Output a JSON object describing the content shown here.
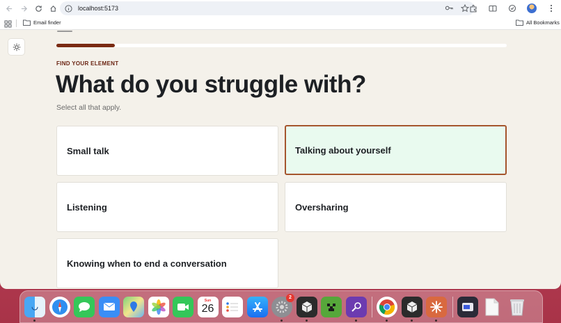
{
  "browser": {
    "url": "localhost:5173",
    "bookmarks": {
      "folder_1": "Email finder",
      "all_bookmarks": "All Bookmarks"
    }
  },
  "quiz": {
    "progress_fraction": 0.13,
    "eyebrow": "FIND YOUR ELEMENT",
    "title": "What do you struggle with?",
    "subtitle": "Select all that apply.",
    "options": [
      {
        "label": "Small talk",
        "selected": false
      },
      {
        "label": "Talking about yourself",
        "selected": true
      },
      {
        "label": "Listening",
        "selected": false
      },
      {
        "label": "Oversharing",
        "selected": false
      },
      {
        "label": "Knowing when to end a conversation",
        "selected": false
      }
    ]
  },
  "dock": {
    "calendar": {
      "month": "Sun",
      "day": "26"
    },
    "settings_badge": "2",
    "apps": [
      "finder-icon",
      "safari-icon",
      "messages-icon",
      "mail-icon",
      "maps-icon",
      "photos-icon",
      "facetime-icon",
      "calendar-icon",
      "reminders-icon",
      "app-store-icon",
      "system-settings-icon",
      "app-icon",
      "minecraft-icon",
      "app-icon",
      "chrome-icon",
      "app-icon",
      "claude-icon",
      "app-icon",
      "document-icon",
      "trash-icon"
    ]
  }
}
